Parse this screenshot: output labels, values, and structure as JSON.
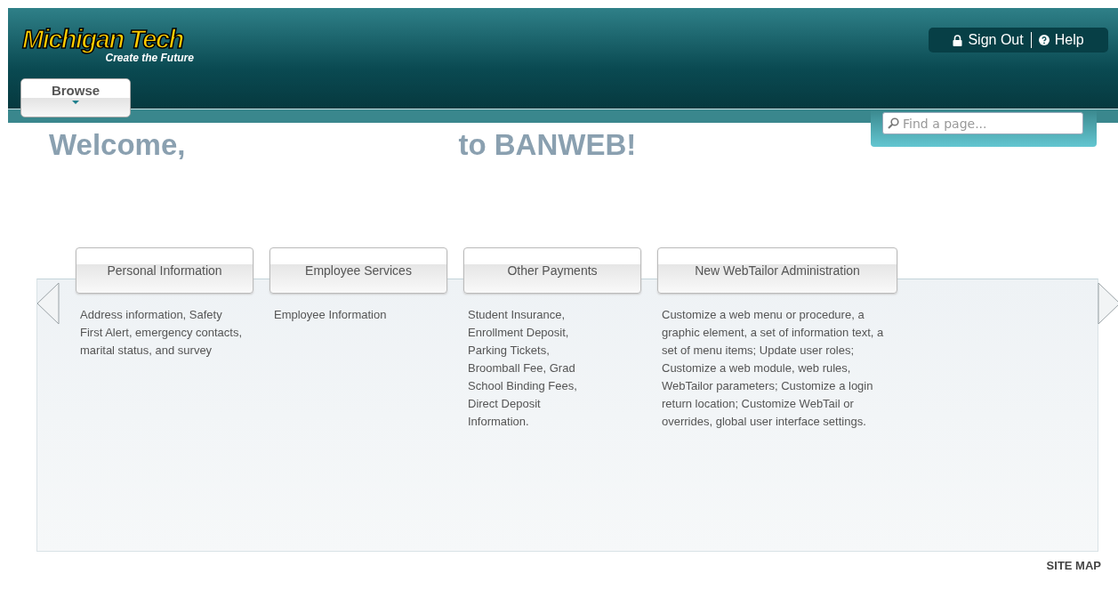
{
  "header": {
    "logo": "Michigan Tech",
    "tagline": "Create the Future",
    "browse_button": "Browse",
    "sign_out": "Sign Out",
    "help": "Help"
  },
  "search": {
    "placeholder": "Find a page..."
  },
  "welcome": {
    "greeting": "Welcome,",
    "suffix": "to BANWEB!"
  },
  "categories": [
    {
      "title": "Personal Information",
      "description": "Address information, Safety First Alert, emergency contacts, marital status, and survey"
    },
    {
      "title": "Employee Services",
      "description": "Employee Information"
    },
    {
      "title": "Other Payments",
      "description": "Student Insurance, Enrollment Deposit, Parking Tickets, Broomball Fee, Grad School Binding Fees, Direct Deposit Information."
    },
    {
      "title": "New WebTailor Administration",
      "description": "Customize a web menu or procedure, a graphic element, a set of information text, a set of menu items; Update user roles; Customize a web module, web rules, WebTailor parameters; Customize a login return location; Customize WebTail or overrides, global user interface settings."
    }
  ],
  "footer": {
    "site_map": "SITE MAP"
  }
}
